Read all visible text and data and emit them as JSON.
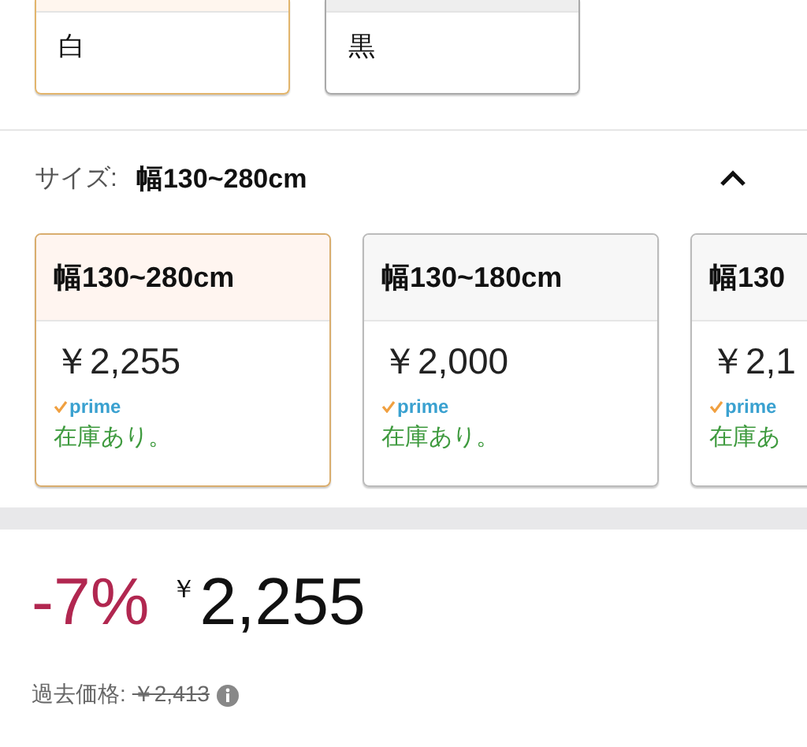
{
  "colors": [
    {
      "label": "白",
      "selected": true
    },
    {
      "label": "黒",
      "selected": false
    }
  ],
  "size": {
    "label": "サイズ:",
    "value": "幅130~280cm",
    "expanded": true
  },
  "size_options": [
    {
      "name": "幅130~280cm",
      "price": "￥2,255",
      "prime": "prime",
      "stock": "在庫あり。",
      "selected": true
    },
    {
      "name": "幅130~180cm",
      "price": "￥2,000",
      "prime": "prime",
      "stock": "在庫あり。",
      "selected": false
    },
    {
      "name": "幅130",
      "price": "￥2,1",
      "prime": "prime",
      "stock": "在庫あ",
      "selected": false
    }
  ],
  "price": {
    "discount": "-7%",
    "currency": "￥",
    "amount": "2,255",
    "past_label": "過去価格:",
    "past_price": "￥2,413"
  }
}
